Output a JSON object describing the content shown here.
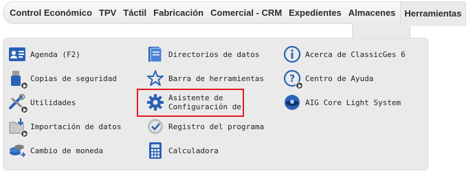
{
  "menubar": {
    "items": [
      {
        "label": "Control Económico"
      },
      {
        "label": "TPV"
      },
      {
        "label": "Táctil"
      },
      {
        "label": "Fabricación"
      },
      {
        "label": "Comercial - CRM"
      },
      {
        "label": "Expedientes"
      },
      {
        "label": "Almacenes"
      },
      {
        "label": "Herramientas"
      }
    ],
    "icons": [
      "headset-icon",
      "exit-door-icon"
    ]
  },
  "panel": {
    "col1": [
      {
        "label": "Agenda (F2)",
        "icon": "agenda-contact-card-icon"
      },
      {
        "label": "Copias de seguridad",
        "icon": "usb-backup-icon"
      },
      {
        "label": "Utilidades",
        "icon": "tools-icon"
      },
      {
        "label": "Importación de datos",
        "icon": "import-folder-icon"
      },
      {
        "label": "Cambio de moneda",
        "icon": "currency-change-icon"
      }
    ],
    "col2": [
      {
        "label": "Directorios de datos",
        "icon": "data-directory-icon"
      },
      {
        "label": "Barra de herramientas",
        "icon": "star-icon"
      },
      {
        "label": "Asistente de\nConfiguración de",
        "icon": "gear-icon"
      },
      {
        "label": "Registro del programa",
        "icon": "registration-check-icon"
      },
      {
        "label": "Calculadora",
        "icon": "calculator-icon"
      }
    ],
    "col3": [
      {
        "label": "Acerca de ClassicGes 6",
        "icon": "info-icon"
      },
      {
        "label": "Centro de Ayuda",
        "icon": "help-icon"
      },
      {
        "label": "AIG Core Light System",
        "icon": "aig-core-icon"
      }
    ]
  },
  "colors": {
    "highlight": "#e0191f",
    "icon_blue": "#2a62b5",
    "panel_bg": "#eaeaea"
  }
}
